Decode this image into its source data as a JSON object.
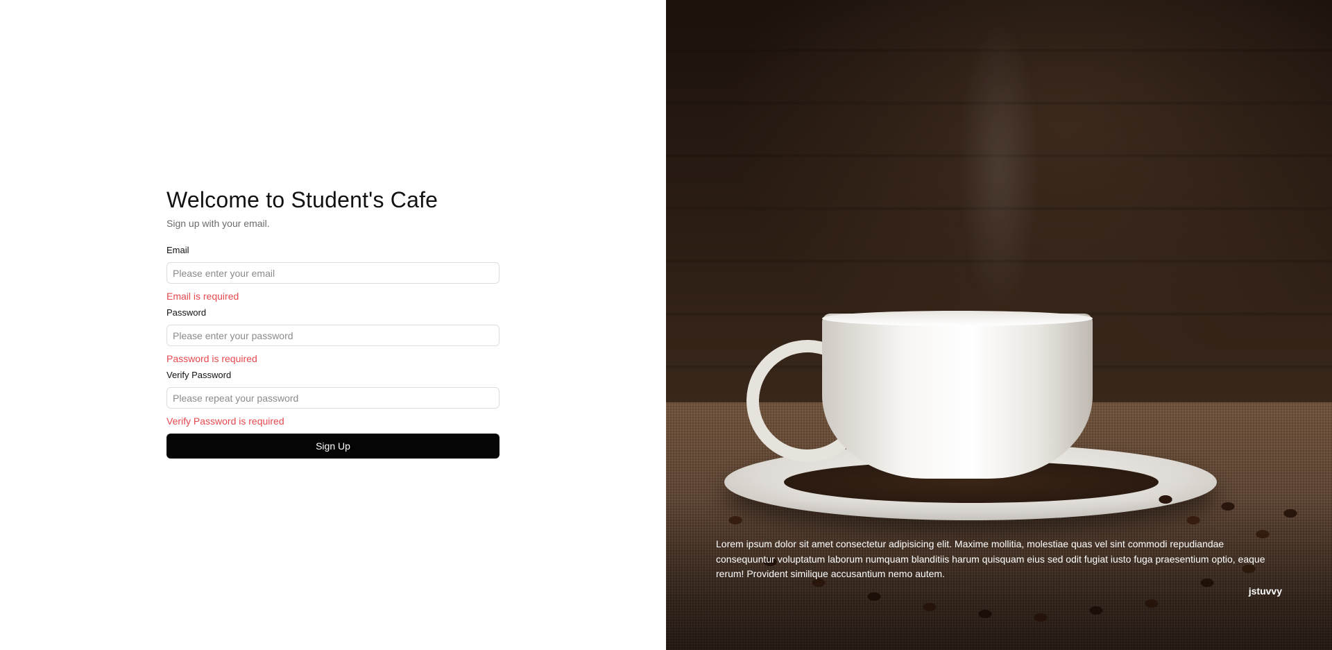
{
  "signup": {
    "title": "Welcome to Student's Cafe",
    "subtitle": "Sign up with your email.",
    "fields": [
      {
        "label": "Email",
        "placeholder": "Please enter your email",
        "value": "",
        "error": "Email is required"
      },
      {
        "label": "Password",
        "placeholder": "Please enter your password",
        "value": "",
        "error": "Password is required"
      },
      {
        "label": "Verify Password",
        "placeholder": "Please repeat your password",
        "value": "",
        "error": "Verify Password is required"
      }
    ],
    "submit_label": "Sign Up"
  },
  "hero": {
    "quote": "Lorem ipsum dolor sit amet consectetur adipisicing elit. Maxime mollitia, molestiae quas vel sint commodi repudiandae consequuntur voluptatum laborum numquam blanditiis harum quisquam eius sed odit fugiat iusto fuga praesentium optio, eaque rerum! Provident similique accusantium nemo autem.",
    "author": "jstuvvy"
  },
  "colors": {
    "error": "#e5484d",
    "button_bg": "#050505",
    "button_text": "#ffffff"
  }
}
